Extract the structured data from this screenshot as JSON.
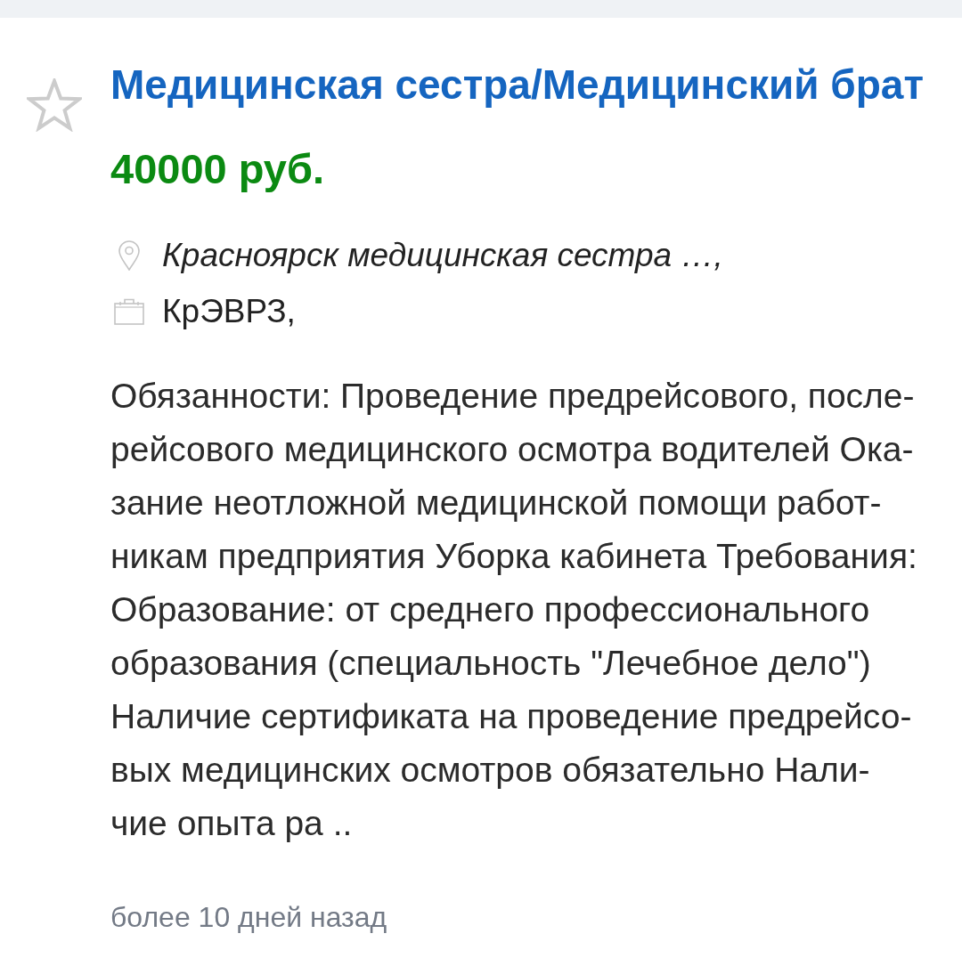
{
  "vacancy": {
    "favorite": false,
    "title": "Медицинская сестра/Медицинский брат",
    "salary": "40000 руб.",
    "location": "Красноярск медицинская сестра …,",
    "company": "КрЭВРЗ,",
    "description_lines": [
      "Обязанности: Проведение предрейсового, после-",
      "рейсового медицинского осмотра водителей Ока-",
      "зание неотложной медицинской помощи работ-",
      "никам предприятия Уборка кабинета Требования:",
      "Образование: от среднего профессионального",
      "образования (специальность \"Лечебное дело\")",
      "Наличие сертификата на проведение предрейсо-",
      "вых медицинских осмотров обязательно Нали-",
      "чие опыта ра .."
    ],
    "posted": "более 10 дней назад"
  }
}
